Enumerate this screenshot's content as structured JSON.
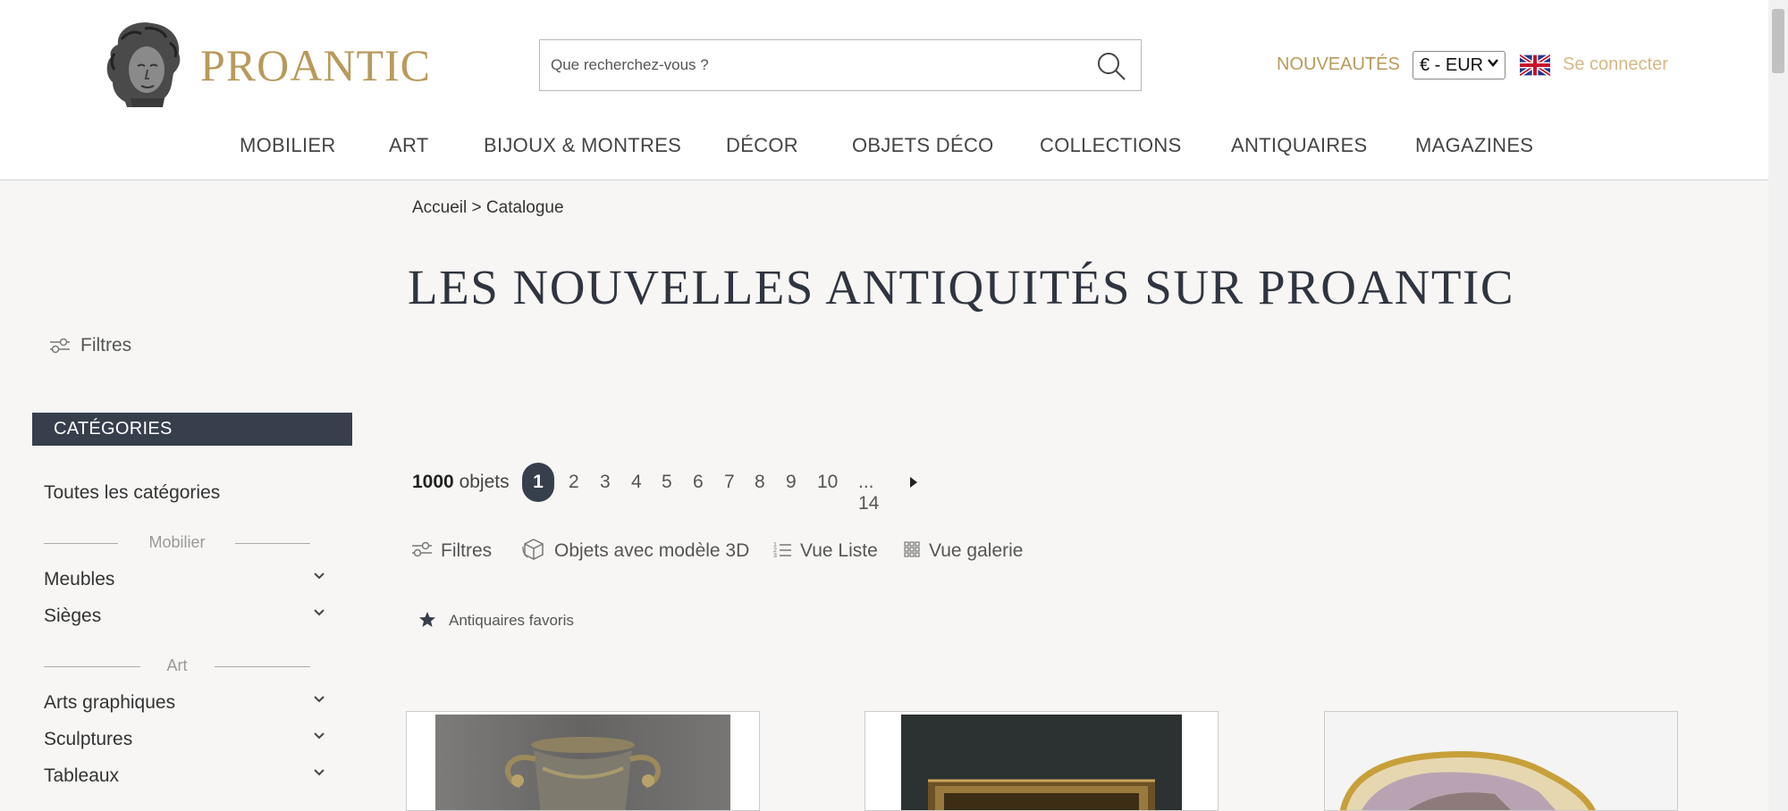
{
  "header": {
    "logo_text": "PROANTIC",
    "search_placeholder": "Que recherchez-vous ?",
    "nouveautes_label": "NOUVEAUTÉS",
    "currency_value": "€ - EUR",
    "language_icon": "uk-flag-icon",
    "login_label": "Se connecter"
  },
  "nav": {
    "items": [
      "MOBILIER",
      "ART",
      "BIJOUX & MONTRES",
      "DÉCOR",
      "OBJETS DÉCO",
      "COLLECTIONS",
      "ANTIQUAIRES",
      "MAGAZINES"
    ]
  },
  "breadcrumb": {
    "home": "Accueil",
    "separator": ">",
    "current": "Catalogue"
  },
  "page_title": "LES NOUVELLES ANTIQUITÉS SUR PROANTIC",
  "sidebar": {
    "filters_label": "Filtres",
    "categories_header": "CATÉGORIES",
    "all_categories": "Toutes les catégories",
    "group_mobilier": "Mobilier",
    "meubles": "Meubles",
    "sieges": "Sièges",
    "group_art": "Art",
    "arts_graphiques": "Arts graphiques",
    "sculptures": "Sculptures",
    "tableaux": "Tableaux"
  },
  "results": {
    "count": "1000",
    "count_suffix": "objets",
    "pages": [
      "1",
      "2",
      "3",
      "4",
      "5",
      "6",
      "7",
      "8",
      "9",
      "10"
    ],
    "ellipsis_last": "... 14",
    "current_page": "1"
  },
  "toolbar": {
    "filters": "Filtres",
    "models_3d": "Objets avec modèle 3D",
    "list_view": "Vue Liste",
    "gallery_view": "Vue galerie",
    "favorite_dealers": "Antiquaires favoris"
  },
  "colors": {
    "brand_gold": "#b99a5b",
    "dark_slate": "#373f4c",
    "background": "#f7f6f4"
  }
}
